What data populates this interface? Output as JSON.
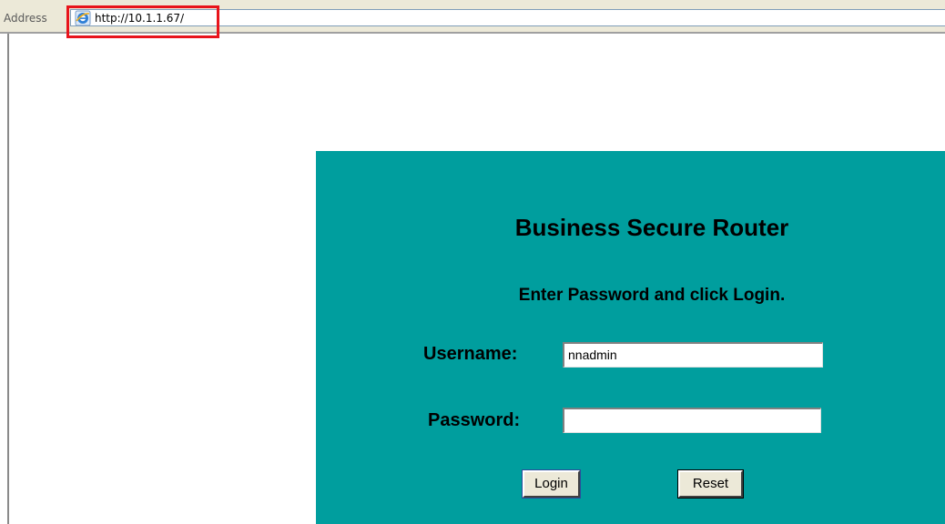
{
  "browser": {
    "address_label": "Address",
    "url": "http://10.1.1.67/",
    "highlight_color": "#e8141b"
  },
  "login": {
    "title": "Business Secure Router",
    "subtitle": "Enter Password and click Login.",
    "username_label": "Username:",
    "username_value": "nnadmin",
    "password_label": "Password:",
    "password_value": "",
    "login_button": "Login",
    "reset_button": "Reset",
    "panel_color": "#009e9e"
  }
}
